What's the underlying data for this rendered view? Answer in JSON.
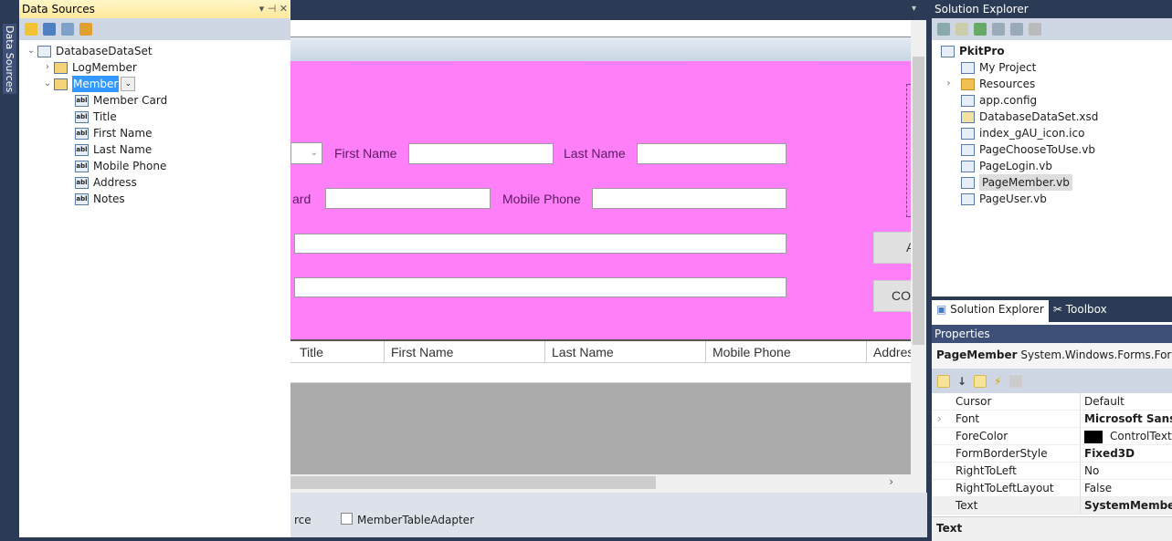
{
  "data_sources": {
    "tab_label": "Data Sources",
    "title": "Data Sources",
    "root": "DatabaseDataSet",
    "tables": [
      {
        "name": "LogMember",
        "expanded": false
      },
      {
        "name": "Member",
        "expanded": true,
        "fields": [
          "Member Card",
          "Title",
          "First Name",
          "Last Name",
          "Mobile Phone",
          "Address",
          "Notes"
        ]
      }
    ]
  },
  "form": {
    "labels": {
      "first_name": "First Name",
      "last_name": "Last Name",
      "card_partial": "ard",
      "mobile_phone": "Mobile Phone"
    },
    "buttons": [
      "A",
      "CO"
    ],
    "grid_columns": [
      "Title",
      "First Name",
      "Last Name",
      "Mobile Phone",
      "Addres"
    ],
    "tray": [
      "rce",
      "MemberTableAdapter"
    ],
    "bg_color": "#ff7ff8"
  },
  "solution_explorer": {
    "title": "Solution Explorer",
    "project": "PkitPro",
    "items": [
      "My Project",
      "Resources",
      "app.config",
      "DatabaseDataSet.xsd",
      "index_gAU_icon.ico",
      "PageChooseToUse.vb",
      "PageLogin.vb",
      "PageMember.vb",
      "PageUser.vb"
    ],
    "selected": "PageMember.vb",
    "tabs": [
      "Solution Explorer",
      "Toolbox"
    ]
  },
  "properties": {
    "title": "Properties",
    "object_name": "PageMember",
    "object_type": "System.Windows.Forms.Form",
    "rows": [
      {
        "name": "Cursor",
        "value": "Default"
      },
      {
        "name": "Font",
        "value": "Microsoft Sans Se"
      },
      {
        "name": "ForeColor",
        "value": "ControlText"
      },
      {
        "name": "FormBorderStyle",
        "value": "Fixed3D"
      },
      {
        "name": "RightToLeft",
        "value": "No"
      },
      {
        "name": "RightToLeftLayout",
        "value": "False"
      },
      {
        "name": "Text",
        "value": "SystemMember"
      }
    ],
    "description": "Text"
  }
}
